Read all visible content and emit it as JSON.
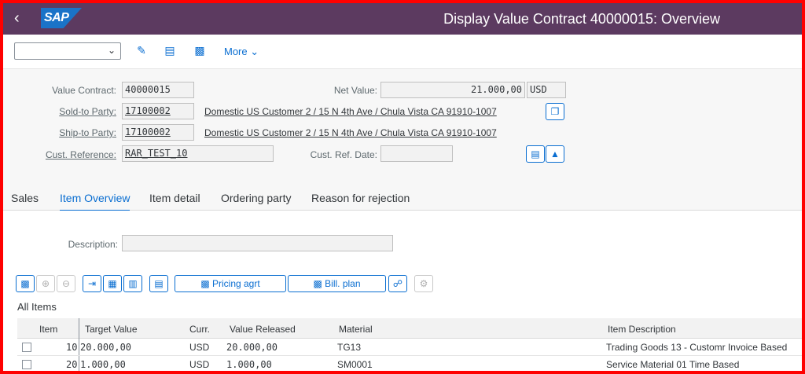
{
  "shell": {
    "back_icon": "back-arrow-icon",
    "logo": "SAP",
    "title": "Display Value Contract 40000015: Overview"
  },
  "toolbar": {
    "select_value": "",
    "more_label": "More"
  },
  "header": {
    "value_contract_label": "Value Contract:",
    "value_contract": "40000015",
    "net_value_label": "Net Value:",
    "net_value": "21.000,00",
    "currency": "USD",
    "sold_to_label": "Sold-to Party:",
    "sold_to": "17100002",
    "sold_to_desc": "Domestic US Customer 2 / 15 N 4th Ave / Chula Vista CA 91910-1007",
    "ship_to_label": "Ship-to Party:",
    "ship_to": "17100002",
    "ship_to_desc": "Domestic US Customer 2 / 15 N 4th Ave / Chula Vista CA 91910-1007",
    "cust_ref_label": "Cust. Reference:",
    "cust_ref": "RAR_TEST_10",
    "cust_ref_date_label": "Cust. Ref. Date:",
    "cust_ref_date": ""
  },
  "tabs": [
    "Sales",
    "Item Overview",
    "Item detail",
    "Ordering party",
    "Reason for rejection"
  ],
  "item_overview": {
    "description_label": "Description:",
    "description": "",
    "pricing_btn": "Pricing agrt",
    "bill_plan_btn": "Bill. plan",
    "all_items": "All Items"
  },
  "table": {
    "headers": [
      "Item",
      "Target Value",
      "Curr.",
      "Value Released",
      "Material",
      "Item Description"
    ],
    "rows": [
      {
        "item": "10",
        "target": "20.000,00",
        "curr": "USD",
        "released": "20.000,00",
        "material": "TG13",
        "desc": "Trading Goods 13 - Customr Invoice Based"
      },
      {
        "item": "20",
        "target": "1.000,00",
        "curr": "USD",
        "released": "1.000,00",
        "material": "SM0001",
        "desc": "Service Material 01 Time Based"
      }
    ]
  }
}
